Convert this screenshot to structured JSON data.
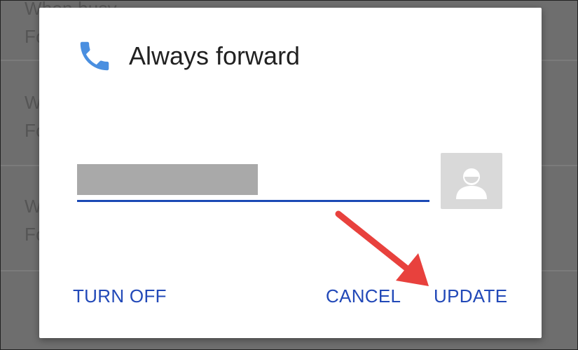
{
  "background_list": {
    "rows": [
      {
        "line1": "When busy",
        "line2": "Fo"
      },
      {
        "line1": "W",
        "line2": "Fo"
      },
      {
        "line1": "W",
        "line2": "Fo"
      }
    ]
  },
  "dialog": {
    "title": "Always forward",
    "icon": "phone-icon",
    "number_field": {
      "value": ""
    },
    "contact_button_icon": "contact-avatar-icon",
    "actions": {
      "turn_off": "TURN OFF",
      "cancel": "CANCEL",
      "update": "UPDATE"
    }
  },
  "colors": {
    "accent": "#2249B8",
    "underline": "#1B49B5",
    "annotation_arrow": "#E8413D",
    "phone_icon": "#4A8FE0",
    "scrim": "#6E6E6E"
  }
}
